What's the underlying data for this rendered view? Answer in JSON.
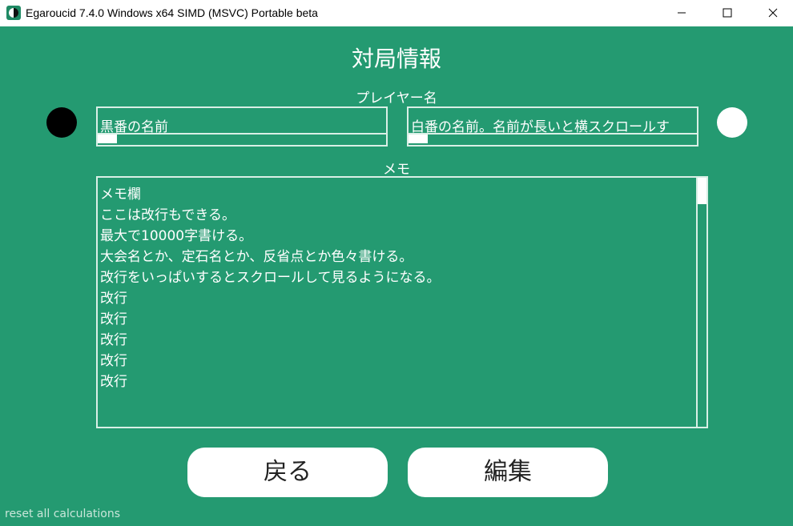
{
  "window": {
    "title": "Egaroucid 7.4.0 Windows x64 SIMD (MSVC) Portable beta"
  },
  "page": {
    "title": "対局情報",
    "player_label": "プレイヤー名",
    "memo_label": "メモ"
  },
  "players": {
    "black_name": "黒番の名前",
    "white_name": "白番の名前。名前が長いと横スクロールす"
  },
  "memo": {
    "lines": [
      "メモ欄",
      "ここは改行もできる。",
      "最大で10000字書ける。",
      "大会名とか、定石名とか、反省点とか色々書ける。",
      "改行をいっぱいするとスクロールして見るようになる。",
      "改行",
      "改行",
      "改行",
      "改行",
      "改行"
    ]
  },
  "buttons": {
    "back": "戻る",
    "edit": "編集"
  },
  "footer": {
    "reset": "reset all calculations"
  },
  "colors": {
    "background": "#249a71",
    "text": "#ffffff"
  }
}
